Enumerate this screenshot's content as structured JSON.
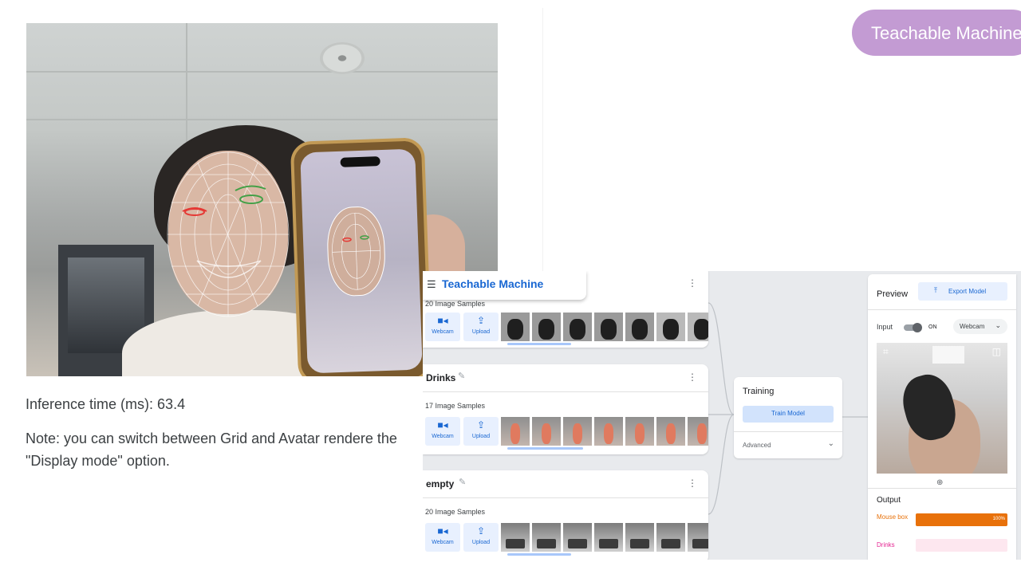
{
  "slide": {
    "title": "Teachable Machine",
    "accent": "#c39bd3"
  },
  "facemesh": {
    "inference_label": "Inference time (ms): 63.4",
    "note": "Note: you can switch between Grid and Avatar rendere the \"Display mode\" option."
  },
  "tm": {
    "brand": "Teachable Machine",
    "brand_color": "#1967d2",
    "classes": [
      {
        "name": "",
        "samples": "20 Image Samples",
        "webcam_label": "Webcam",
        "upload_label": "Upload"
      },
      {
        "name": "Drinks",
        "samples": "17 Image Samples",
        "webcam_label": "Webcam",
        "upload_label": "Upload"
      },
      {
        "name": "empty",
        "samples": "20 Image Samples",
        "webcam_label": "Webcam",
        "upload_label": "Upload"
      }
    ],
    "training": {
      "title": "Training",
      "train_button": "Train Model",
      "advanced": "Advanced"
    },
    "preview": {
      "title": "Preview",
      "export_button": "Export Model",
      "input_label": "Input",
      "toggle_state": "ON",
      "source": "Webcam",
      "output_label": "Output",
      "outputs": [
        {
          "name": "Mouse box",
          "percent_label": "100%",
          "percent": 100,
          "color": "#e8710a",
          "track": "#fbe0c8"
        },
        {
          "name": "Drinks",
          "percent_label": "",
          "percent": 0,
          "color": "#e52592",
          "track": "#fde7ef"
        }
      ]
    }
  }
}
